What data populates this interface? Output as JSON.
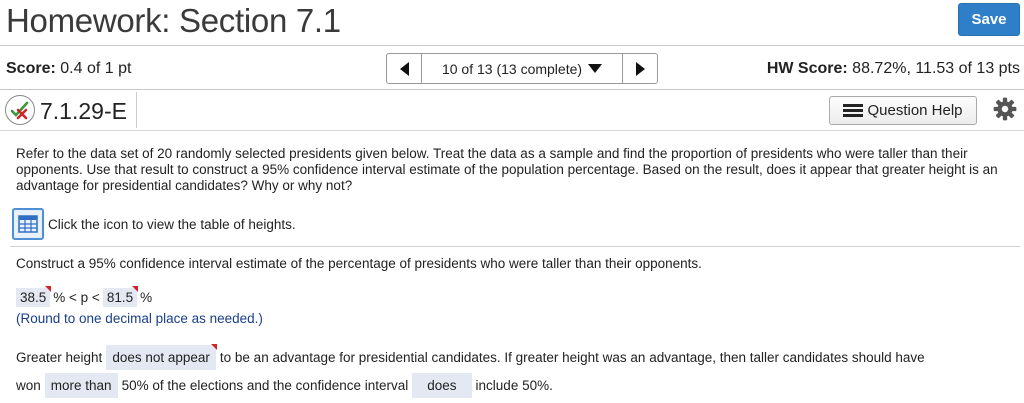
{
  "header": {
    "title": "Homework: Section 7.1",
    "save_label": "Save"
  },
  "score": {
    "label": "Score:",
    "value": "0.4 of 1 pt"
  },
  "nav": {
    "position_text": "10 of 13 (13 complete)"
  },
  "hw_score": {
    "label": "HW Score:",
    "value": "88.72%, 11.53 of 13 pts"
  },
  "question": {
    "id": "7.1.29-E",
    "help_label": "Question Help",
    "prompt": "Refer to the data set of 20 randomly selected presidents given below. Treat the data as a sample and find the proportion of presidents who were taller than their opponents. Use that result to construct a 95% confidence interval estimate of the population percentage. Based on the result, does it appear that greater height is an advantage for presidential candidates? Why or why not?",
    "table_link_text": "Click the icon to view the table of heights.",
    "part_prompt": "Construct a 95% confidence interval estimate of the percentage of presidents who were taller than their opponents.",
    "ci_lower": "38.5",
    "ci_mid": "% < p <",
    "ci_upper": "81.5",
    "ci_unit": "%",
    "round_note": "(Round to one decimal place as needed.)",
    "conclusion": {
      "t1": "Greater height",
      "dd1": "does not appear",
      "t2": "to be an advantage for presidential candidates. If greater height was an advantage, then taller candidates should have",
      "t3": "won",
      "dd2": "more than",
      "t4": "50% of the elections and the confidence interval",
      "dd3": "does",
      "t5": "include 50%."
    }
  },
  "colors": {
    "save_button": "#2f7fc8",
    "answer_box": "#e3e8f2",
    "incorrect_mark": "#d0262b",
    "note_text": "#1a3e8c"
  },
  "icons": [
    "partial-credit-icon",
    "list-icon",
    "gear-icon",
    "table-grid-icon",
    "left-arrow-icon",
    "right-arrow-icon",
    "dropdown-arrow-icon"
  ]
}
